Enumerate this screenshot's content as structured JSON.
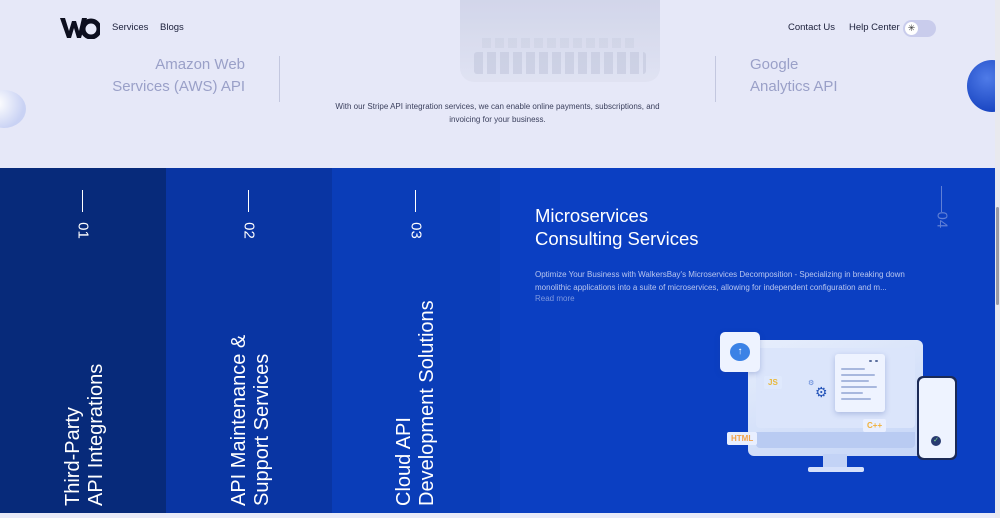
{
  "header": {
    "nav_left": [
      "Services",
      "Blogs"
    ],
    "nav_right": [
      "Contact Us",
      "Help Center"
    ],
    "theme_toggle_icon": "sun-icon"
  },
  "hero": {
    "api_left": [
      "Amazon Web",
      "Services (AWS) API"
    ],
    "api_right": [
      "Google",
      "Analytics API"
    ],
    "description_line1": "With our Stripe API integration services, we can enable online payments, subscriptions, and",
    "description_line2": "invoicing for your business."
  },
  "services": [
    {
      "number": "01",
      "title_line1": "Third-Party",
      "title_line2": "API Integrations"
    },
    {
      "number": "02",
      "title_line1": "API Maintenance &",
      "title_line2": "Support Services"
    },
    {
      "number": "03",
      "title_line1": "Cloud API",
      "title_line2": "Development Solutions"
    }
  ],
  "active_service": {
    "number": "04",
    "title_line1": "Microservices",
    "title_line2": "Consulting Services",
    "description_line1": "Optimize Your Business with WalkersBay's Microservices Decomposition - Specializing in breaking down",
    "description_line2": "monolithic applications into a suite of microservices, allowing for independent configuration and m...",
    "read_more": "Read more",
    "illustration_tags": [
      "JS",
      "HTML",
      "C++"
    ]
  },
  "colors": {
    "panel1": "#072a7a",
    "panel2": "#0935a3",
    "panel3": "#0a3db8",
    "panel4": "#0b3fc2",
    "hero_bg": "#e6e8f8"
  }
}
